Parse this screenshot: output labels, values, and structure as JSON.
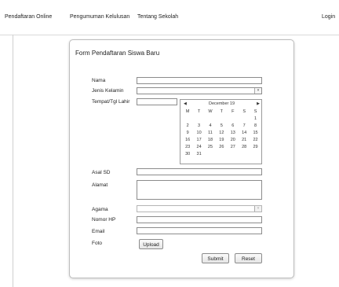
{
  "nav": {
    "items": [
      "Pendaftaran Online",
      "Pengumuman Kelulusan",
      "Tentang Sekolah"
    ],
    "login": "Login"
  },
  "form": {
    "title": "Form Pendaftaran Siswa Baru",
    "labels": {
      "nama": "Nama",
      "jenis_kelamin": "Jenis Kelamin",
      "tempat_tgl_lahir": "Tempat/Tgl Lahir",
      "asal_sd": "Asal SD",
      "alamat": "Alamat",
      "agama": "Agama",
      "nomor_hp": "Nomor HP",
      "email": "Email",
      "foto": "Foto"
    },
    "upload_label": "Upload",
    "submit_label": "Submit",
    "reset_label": "Reset"
  },
  "calendar": {
    "title": "December 19",
    "prev": "◀",
    "next": "▶",
    "weekdays": [
      "M",
      "T",
      "W",
      "T",
      "F",
      "S",
      "S"
    ],
    "weeks": [
      [
        "",
        "",
        "",
        "",
        "",
        "",
        "1"
      ],
      [
        "2",
        "3",
        "4",
        "5",
        "6",
        "7",
        "8"
      ],
      [
        "9",
        "10",
        "11",
        "12",
        "13",
        "14",
        "15"
      ],
      [
        "16",
        "17",
        "18",
        "19",
        "20",
        "21",
        "22"
      ],
      [
        "23",
        "24",
        "25",
        "26",
        "27",
        "28",
        "29"
      ],
      [
        "30",
        "31",
        "",
        "",
        "",
        "",
        ""
      ]
    ]
  },
  "icons": {
    "dropdown": "chevron-down-icon"
  }
}
